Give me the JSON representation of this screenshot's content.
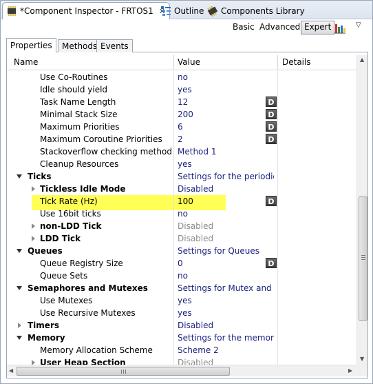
{
  "tabs": [
    {
      "label": "*Component Inspector - FRTOS1",
      "icon": "component-inspector-icon"
    },
    {
      "label": "Outline",
      "icon": "outline-icon"
    },
    {
      "label": "Components Library",
      "icon": "components-library-icon"
    }
  ],
  "toolbar": {
    "basic": "Basic",
    "advanced": "Advanced",
    "expert": "Expert",
    "chart_icon": "bar-chart-icon",
    "menu_icon": "view-menu-icon"
  },
  "inner_tabs": [
    "Properties",
    "Methods",
    "Events"
  ],
  "columns": {
    "name": "Name",
    "value": "Value",
    "details": "Details"
  },
  "rows": [
    {
      "name": "Use Co-Routines",
      "value": "no"
    },
    {
      "name": "Idle should yield",
      "value": "yes"
    },
    {
      "name": "Task Name Length",
      "value": "12",
      "d": "D"
    },
    {
      "name": "Minimal Stack Size",
      "value": "200",
      "d": "D"
    },
    {
      "name": "Maximum Priorities",
      "value": "6",
      "d": "D"
    },
    {
      "name": "Maximum Coroutine Priorities",
      "value": "2",
      "d": "D"
    },
    {
      "name": "Stackoverflow checking method",
      "value": "Method 1"
    },
    {
      "name": "Cleanup Resources",
      "value": "yes"
    },
    {
      "name": "Ticks",
      "value": "Settings for the periodic t...",
      "bold": true,
      "level": 0,
      "toggle": "down"
    },
    {
      "name": "Tickless Idle Mode",
      "value": "Disabled",
      "bold": true,
      "level": 1,
      "toggle": "right"
    },
    {
      "name": "Tick Rate (Hz)",
      "value": "100",
      "d": "D",
      "highlight": true
    },
    {
      "name": "Use 16bit ticks",
      "value": "no"
    },
    {
      "name": "non-LDD Tick",
      "value": "Disabled",
      "bold": true,
      "level": 1,
      "toggle": "right",
      "disabled": true
    },
    {
      "name": "LDD Tick",
      "value": "Disabled",
      "bold": true,
      "level": 1,
      "toggle": "right",
      "disabled": true
    },
    {
      "name": "Queues",
      "value": "Settings for Queues",
      "bold": true,
      "level": 0,
      "toggle": "down"
    },
    {
      "name": "Queue Registry Size",
      "value": "0",
      "d": "D"
    },
    {
      "name": "Queue Sets",
      "value": "no"
    },
    {
      "name": "Semaphores and Mutexes",
      "value": "Settings for Mutex and Se...",
      "bold": true,
      "level": 0,
      "toggle": "down"
    },
    {
      "name": "Use Mutexes",
      "value": "yes"
    },
    {
      "name": "Use Recursive Mutexes",
      "value": "yes"
    },
    {
      "name": "Timers",
      "value": "Disabled",
      "bold": true,
      "level": 0,
      "toggle": "right"
    },
    {
      "name": "Memory",
      "value": "Settings for the memory ...",
      "bold": true,
      "level": 0,
      "toggle": "down"
    },
    {
      "name": "Memory Allocation Scheme",
      "value": "Scheme 2"
    },
    {
      "name": "User Heap Section",
      "value": "Disabled",
      "bold": true,
      "level": 1,
      "toggle": "right",
      "disabled": true
    }
  ]
}
